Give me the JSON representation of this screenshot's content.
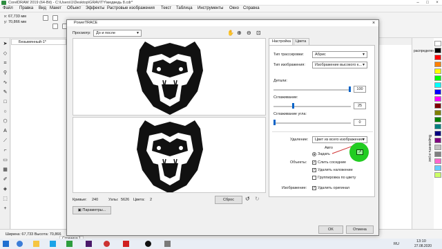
{
  "app": {
    "title": "CorelDRAW 2019 (64-Bit) - C:\\Users\\1\\Desktop\\GRAVITY\\медведь 8.cdr*"
  },
  "menu": [
    "Файл",
    "Правка",
    "Вид",
    "Макет",
    "Объект",
    "Эффекты",
    "Растровые изображения",
    "Текст",
    "Таблица",
    "Инструменты",
    "Окно",
    "Справка"
  ],
  "toolbar": {
    "x_value": "67,733 мм",
    "y_value": "70,866 мм"
  },
  "document_tab": "Безымянный-1*",
  "dialog": {
    "title": "PowerTRACE",
    "view_label": "Просмотр:",
    "view_value": "До и после",
    "stats": {
      "curves_label": "Кривые:",
      "curves": "240",
      "nodes_label": "Узлы:",
      "nodes": "5626",
      "colors_label": "Цвета:",
      "colors": "2"
    },
    "reset_button": "Сброс",
    "params_button": "Параметры...",
    "ok_button": "OK",
    "cancel_button": "Отмена",
    "tabs": [
      "Настройка",
      "Цвета"
    ],
    "trace_type_label": "Тип трассировки:",
    "trace_type_value": "Абрис",
    "image_type_label": "Тип изображения:",
    "image_type_value": "Изображение высокого к...",
    "detail_label": "Детали:",
    "detail_value": "100",
    "smoothing_label": "Сглаживание:",
    "smoothing_value": "25",
    "corner_label": "Сглаживание угла:",
    "corner_value": "0",
    "removal_label": "Удаление:",
    "removal_value": "Цвет из всего изображения",
    "removal_auto": "Авто",
    "removal_set": "Задать",
    "objects_label": "Объекты:",
    "objects": [
      "Слить соседние",
      "Удалить наложение",
      "Группировка по цвету"
    ],
    "image_label": "Изображение:",
    "image_option": "Удалить оригинал"
  },
  "sliders": {
    "detail": 1.0,
    "smoothing": 0.25,
    "corner": 0.0
  },
  "status": {
    "size": "Ширина: 67,733 Высота: 70,866",
    "center": "Центр: (96,863; 207,221)  миллиметры",
    "info": "Растр (Оттенки серого) вкл. Слой 1 300 x 300 точек на дюйм",
    "fill_none": "Нет",
    "outline_none": "Нет",
    "page_tab": "Страница 1"
  },
  "taskbar": {
    "lang": "RU",
    "time": "13:10",
    "date": "27.08.2020"
  },
  "docker": {
    "label1": "Выровнять и рас",
    "label2": "распределение"
  },
  "colors": {
    "green_marker": "#22cc22",
    "palette": [
      "#ffffff",
      "#000000",
      "#ff0000",
      "#ff8000",
      "#ffff00",
      "#00ff00",
      "#00ffff",
      "#0000ff",
      "#ff00ff",
      "#800000",
      "#808000",
      "#008000",
      "#008080",
      "#000080",
      "#800080",
      "#c0c0c0",
      "#808080",
      "#ff66cc",
      "#66ccff",
      "#ccff66"
    ]
  }
}
